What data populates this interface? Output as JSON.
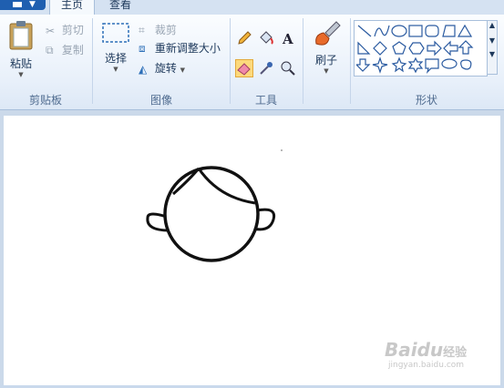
{
  "tabs": [
    {
      "label": "主页",
      "active": true
    },
    {
      "label": "查看",
      "active": false
    }
  ],
  "clipboard": {
    "paste_label": "粘贴",
    "cut_label": "剪切",
    "copy_label": "复制",
    "group_label": "剪贴板"
  },
  "image": {
    "select_label": "选择",
    "crop_label": "裁剪",
    "resize_label": "重新调整大小",
    "rotate_label": "旋转",
    "group_label": "图像"
  },
  "tools": {
    "group_label": "工具",
    "selected_tool": "eraser"
  },
  "brushes": {
    "label": "刷子"
  },
  "shapes": {
    "group_label": "形状"
  },
  "watermark": {
    "brand": "Baidu",
    "brand2": "经验",
    "url": "jingyan.baidu.com"
  },
  "colors": {
    "accent": "#1f5fb0",
    "selected_tool_bg": "#fcd97c",
    "ribbon_bg": "#e8f0fa",
    "canvas_bg": "#ffffff"
  }
}
